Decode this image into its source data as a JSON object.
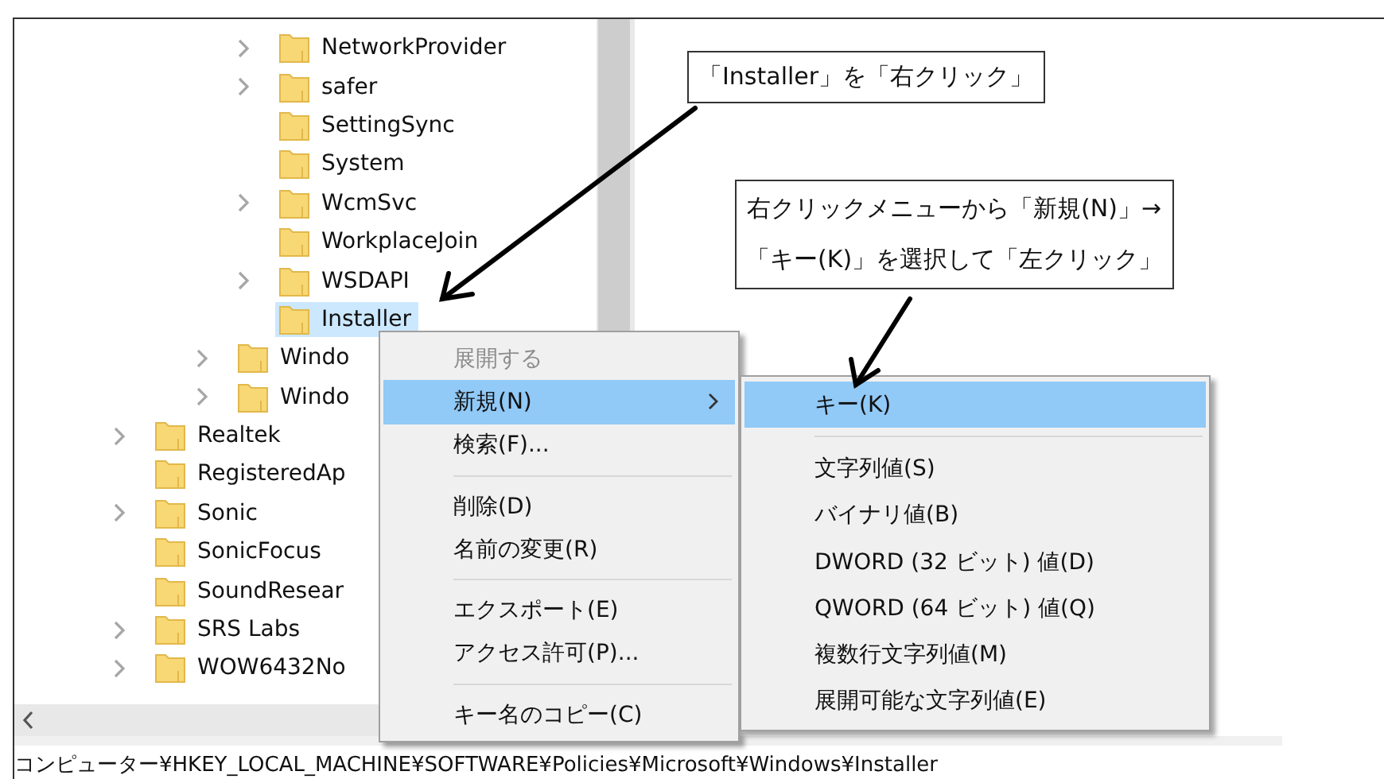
{
  "tree": {
    "items": [
      {
        "children": [
          {
            "children": [
              {
                "children": [
                  {
                    "label": "NetworkProvider",
                    "expandable": true,
                    "selected": false
                  },
                  {
                    "label": "safer",
                    "expandable": true,
                    "selected": false
                  },
                  {
                    "label": "SettingSync",
                    "expandable": false,
                    "selected": false
                  },
                  {
                    "label": "System",
                    "expandable": false,
                    "selected": false
                  },
                  {
                    "label": "WcmSvc",
                    "expandable": true,
                    "selected": false
                  },
                  {
                    "label": "WorkplaceJoin",
                    "expandable": false,
                    "selected": false
                  },
                  {
                    "label": "WSDAPI",
                    "expandable": true,
                    "selected": false
                  },
                  {
                    "label": "Installer",
                    "expandable": false,
                    "selected": true
                  }
                ]
              },
              {
                "label": "Windo",
                "expandable": true,
                "selected": false
              },
              {
                "label": "Windo",
                "expandable": true,
                "selected": false
              }
            ]
          }
        ]
      },
      {
        "label": "Realtek",
        "expandable": true,
        "selected": false
      },
      {
        "label": "RegisteredAp",
        "expandable": false,
        "selected": false
      },
      {
        "label": "Sonic",
        "expandable": true,
        "selected": false
      },
      {
        "label": "SonicFocus",
        "expandable": false,
        "selected": false
      },
      {
        "label": "SoundResear",
        "expandable": false,
        "selected": false
      },
      {
        "label": "SRS Labs",
        "expandable": true,
        "selected": false
      },
      {
        "label": "WOW6432No",
        "expandable": true,
        "selected": false
      }
    ]
  },
  "context_menu": {
    "items": [
      {
        "kind": "item",
        "label": "展開する",
        "disabled": true,
        "selected": false,
        "submenu": false
      },
      {
        "kind": "item",
        "label": "新規(N)",
        "disabled": false,
        "selected": true,
        "submenu": true
      },
      {
        "kind": "item",
        "label": "検索(F)...",
        "disabled": false,
        "selected": false,
        "submenu": false
      },
      {
        "kind": "separator"
      },
      {
        "kind": "item",
        "label": "削除(D)",
        "disabled": false,
        "selected": false,
        "submenu": false
      },
      {
        "kind": "item",
        "label": "名前の変更(R)",
        "disabled": false,
        "selected": false,
        "submenu": false
      },
      {
        "kind": "separator"
      },
      {
        "kind": "item",
        "label": "エクスポート(E)",
        "disabled": false,
        "selected": false,
        "submenu": false
      },
      {
        "kind": "item",
        "label": "アクセス許可(P)...",
        "disabled": false,
        "selected": false,
        "submenu": false
      },
      {
        "kind": "separator"
      },
      {
        "kind": "item",
        "label": "キー名のコピー(C)",
        "disabled": false,
        "selected": false,
        "submenu": false
      }
    ]
  },
  "submenu": {
    "items": [
      {
        "kind": "item",
        "label": "キー(K)",
        "disabled": false,
        "selected": true
      },
      {
        "kind": "separator"
      },
      {
        "kind": "item",
        "label": "文字列値(S)",
        "disabled": false,
        "selected": false
      },
      {
        "kind": "item",
        "label": "バイナリ値(B)",
        "disabled": false,
        "selected": false
      },
      {
        "kind": "item",
        "label": "DWORD (32 ビット) 値(D)",
        "disabled": false,
        "selected": false
      },
      {
        "kind": "item",
        "label": "QWORD (64 ビット) 値(Q)",
        "disabled": false,
        "selected": false
      },
      {
        "kind": "item",
        "label": "複数行文字列値(M)",
        "disabled": false,
        "selected": false
      },
      {
        "kind": "item",
        "label": "展開可能な文字列値(E)",
        "disabled": false,
        "selected": false
      }
    ]
  },
  "callouts": [
    {
      "lines": [
        "「Installer」を「右クリック」"
      ]
    },
    {
      "lines": [
        "右クリックメニューから「新規(N)」→",
        "「キー(K)」を選択して「左クリック」"
      ]
    }
  ],
  "status_bar": {
    "path": "コンピューター¥HKEY_LOCAL_MACHINE¥SOFTWARE¥Policies¥Microsoft¥Windows¥Installer"
  }
}
